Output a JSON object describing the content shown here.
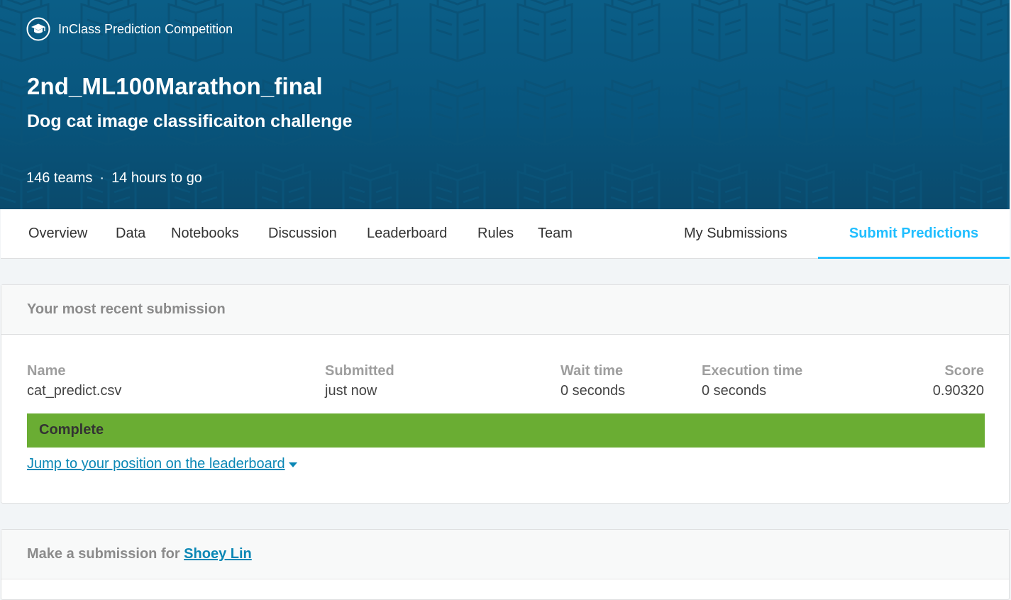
{
  "banner": {
    "competition_type": "InClass Prediction Competition",
    "title": "2nd_ML100Marathon_final",
    "subtitle": "Dog cat image classificaiton challenge",
    "teams": "146 teams",
    "separator": "·",
    "time_left": "14 hours to go",
    "colors": {
      "background": "#0b5e87",
      "pattern": "#0a5378"
    }
  },
  "tabs": {
    "items": [
      {
        "label": "Overview"
      },
      {
        "label": "Data"
      },
      {
        "label": "Notebooks"
      },
      {
        "label": "Discussion"
      },
      {
        "label": "Leaderboard"
      },
      {
        "label": "Rules"
      },
      {
        "label": "Team"
      },
      {
        "label": "My Submissions"
      },
      {
        "label": "Submit Predictions"
      }
    ],
    "active": "Submit Predictions",
    "accent_color": "#20beff"
  },
  "recent_submission": {
    "header": "Your most recent submission",
    "columns": {
      "name": {
        "header": "Name",
        "value": "cat_predict.csv"
      },
      "submitted": {
        "header": "Submitted",
        "value": "just now"
      },
      "wait_time": {
        "header": "Wait time",
        "value": "0 seconds"
      },
      "execution_time": {
        "header": "Execution time",
        "value": "0 seconds"
      },
      "score": {
        "header": "Score",
        "value": "0.90320"
      }
    },
    "status": "Complete",
    "status_color": "#6aad33",
    "jump_link": "Jump to your position on the leaderboard",
    "jump_icon": "caret-down-icon"
  },
  "make_submission": {
    "prefix": "Make a submission for ",
    "user": "Shoey Lin"
  }
}
